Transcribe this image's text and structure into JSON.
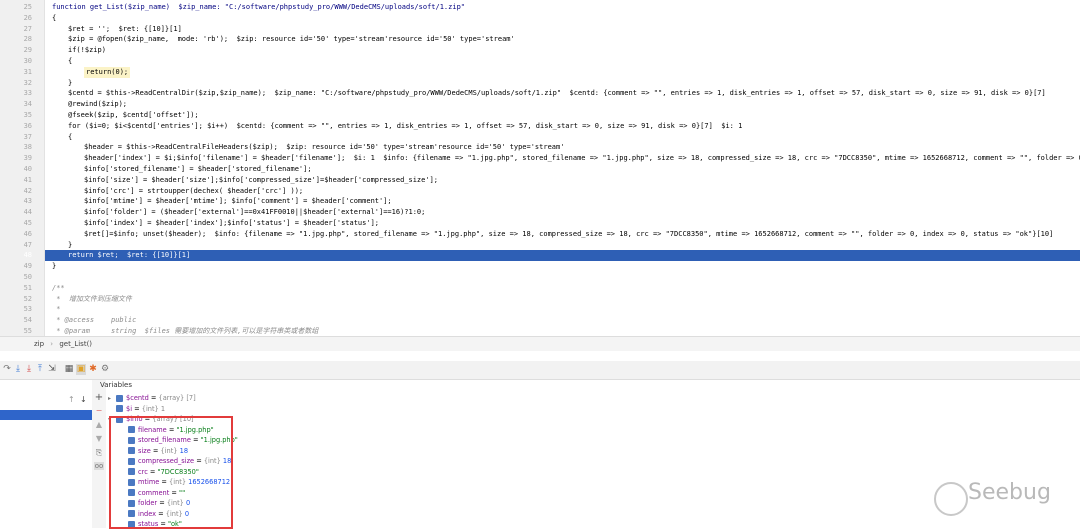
{
  "editor": {
    "lines": [
      {
        "num": "25",
        "text": "function get_List($zip_name)  $zip_name: \"C:/software/phpstudy_pro/WWW/DedeCMS/uploads/soft/1.zip\"",
        "kind": "func"
      },
      {
        "num": "26",
        "text": "{",
        "kind": "plain"
      },
      {
        "num": "27",
        "text": "$ret = '';  $ret: {[10]}[1]",
        "kind": "plain"
      },
      {
        "num": "28",
        "text": "$zip = @fopen($zip_name,  mode: 'rb');  $zip: resource id='50' type='stream'resource id='50' type='stream'",
        "kind": "plain"
      },
      {
        "num": "29",
        "text": "if(!$zip)",
        "kind": "plain"
      },
      {
        "num": "30",
        "text": "{",
        "kind": "plain"
      },
      {
        "num": "31",
        "text": "return(0);",
        "kind": "ret0"
      },
      {
        "num": "32",
        "text": "}",
        "kind": "plain"
      },
      {
        "num": "33",
        "text": "$centd = $this->ReadCentralDir($zip,$zip_name);  $zip_name: \"C:/software/phpstudy_pro/WWW/DedeCMS/uploads/soft/1.zip\"  $centd: {comment => \"\", entries => 1, disk_entries => 1, offset => 57, disk_start => 0, size => 91, disk => 0}[7]",
        "kind": "plain"
      },
      {
        "num": "34",
        "text": "@rewind($zip);",
        "kind": "plain"
      },
      {
        "num": "35",
        "text": "@fseek($zip, $centd['offset']);",
        "kind": "plain"
      },
      {
        "num": "36",
        "text": "for ($i=0; $i<$centd['entries']; $i++)  $centd: {comment => \"\", entries => 1, disk_entries => 1, offset => 57, disk_start => 0, size => 91, disk => 0}[7]  $i: 1",
        "kind": "plain"
      },
      {
        "num": "37",
        "text": "{",
        "kind": "plain"
      },
      {
        "num": "38",
        "text": "$header = $this->ReadCentralFileHeaders($zip);  $zip: resource id='50' type='stream'resource id='50' type='stream'",
        "kind": "plain"
      },
      {
        "num": "39",
        "text": "$header['index'] = $i;$info['filename'] = $header['filename'];  $i: 1  $info: {filename => \"1.jpg.php\", stored_filename => \"1.jpg.php\", size => 18, compressed_size => 18, crc => \"7DCC8350\", mtime => 1652668712, comment => \"\", folder => 0, i",
        "kind": "plain"
      },
      {
        "num": "40",
        "text": "$info['stored_filename'] = $header['stored_filename'];",
        "kind": "plain"
      },
      {
        "num": "41",
        "text": "$info['size'] = $header['size'];$info['compressed_size']=$header['compressed_size'];",
        "kind": "plain"
      },
      {
        "num": "42",
        "text": "$info['crc'] = strtoupper(dechex( $header['crc'] ));",
        "kind": "plain"
      },
      {
        "num": "43",
        "text": "$info['mtime'] = $header['mtime']; $info['comment'] = $header['comment'];",
        "kind": "plain"
      },
      {
        "num": "44",
        "text": "$info['folder'] = ($header['external']==0x41FF0010||$header['external']==16)?1:0;",
        "kind": "plain"
      },
      {
        "num": "45",
        "text": "$info['index'] = $header['index'];$info['status'] = $header['status'];",
        "kind": "plain"
      },
      {
        "num": "46",
        "text": "$ret[]=$info; unset($header);  $info: {filename => \"1.jpg.php\", stored_filename => \"1.jpg.php\", size => 18, compressed_size => 18, crc => \"7DCC8350\", mtime => 1652668712, comment => \"\", folder => 0, index => 0, status => \"ok\"}[10]",
        "kind": "plain"
      },
      {
        "num": "47",
        "text": "}",
        "kind": "plain"
      },
      {
        "num": "48",
        "text": "return $ret;  $ret: {[10]}[1]",
        "kind": "current"
      },
      {
        "num": "49",
        "text": "}",
        "kind": "plain"
      },
      {
        "num": "50",
        "text": "",
        "kind": "plain"
      },
      {
        "num": "51",
        "text": "/**",
        "kind": "comment"
      },
      {
        "num": "52",
        "text": " *  增加文件到压缩文件",
        "kind": "comment"
      },
      {
        "num": "53",
        "text": " *",
        "kind": "comment"
      },
      {
        "num": "54",
        "text": " * @access    public",
        "kind": "comment"
      },
      {
        "num": "55",
        "text": " * @param     string  $files 需要增加的文件列表,可以是字符串类或者数组",
        "kind": "comment"
      }
    ]
  },
  "breadcrumb": {
    "items": [
      "zip",
      "get_List()"
    ]
  },
  "variables": {
    "title": "Variables",
    "rows": [
      {
        "indent": 0,
        "arrow": "▸",
        "name": "$centd",
        "type": "{array} [7]",
        "value": "",
        "vclass": ""
      },
      {
        "indent": 0,
        "arrow": "",
        "name": "$i",
        "type": "{int} 1",
        "value": "",
        "vclass": ""
      },
      {
        "indent": 0,
        "arrow": "▾",
        "name": "$info",
        "type": "{array} [10]",
        "value": "",
        "vclass": ""
      },
      {
        "indent": 1,
        "arrow": "",
        "name": "filename",
        "type": "",
        "value": "\"1.jpg.php\"",
        "vclass": "str"
      },
      {
        "indent": 1,
        "arrow": "",
        "name": "stored_filename",
        "type": "",
        "value": "\"1.jpg.php\"",
        "vclass": "str"
      },
      {
        "indent": 1,
        "arrow": "",
        "name": "size",
        "type": "{int}",
        "value": "18",
        "vclass": "num"
      },
      {
        "indent": 1,
        "arrow": "",
        "name": "compressed_size",
        "type": "{int}",
        "value": "18",
        "vclass": "num"
      },
      {
        "indent": 1,
        "arrow": "",
        "name": "crc",
        "type": "",
        "value": "\"7DCC8350\"",
        "vclass": "str"
      },
      {
        "indent": 1,
        "arrow": "",
        "name": "mtime",
        "type": "{int}",
        "value": "1652668712",
        "vclass": "num"
      },
      {
        "indent": 1,
        "arrow": "",
        "name": "comment",
        "type": "",
        "value": "\"\"",
        "vclass": "str"
      },
      {
        "indent": 1,
        "arrow": "",
        "name": "folder",
        "type": "{int}",
        "value": "0",
        "vclass": "num"
      },
      {
        "indent": 1,
        "arrow": "",
        "name": "index",
        "type": "{int}",
        "value": "0",
        "vclass": "num"
      },
      {
        "indent": 1,
        "arrow": "",
        "name": "status",
        "type": "",
        "value": "\"ok\"",
        "vclass": "str"
      }
    ]
  },
  "watermark": {
    "text": "Seebug"
  },
  "colors": {
    "current_line": "#2e5fb5",
    "ret_highlight": "#fbf3c7",
    "highlight_box": "#e23b3b"
  }
}
